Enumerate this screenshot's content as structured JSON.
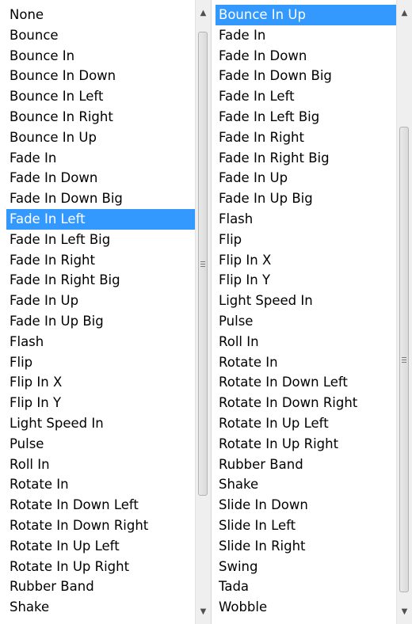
{
  "left_list": {
    "selected_index": 10,
    "items": [
      "None",
      "Bounce",
      "Bounce In",
      "Bounce In Down",
      "Bounce In Left",
      "Bounce In Right",
      "Bounce In Up",
      "Fade In",
      "Fade In Down",
      "Fade In Down Big",
      "Fade In Left",
      "Fade In Left Big",
      "Fade In Right",
      "Fade In Right Big",
      "Fade In Up",
      "Fade In Up Big",
      "Flash",
      "Flip",
      "Flip In X",
      "Flip In Y",
      "Light Speed In",
      "Pulse",
      "Roll In",
      "Rotate In",
      "Rotate In Down Left",
      "Rotate In Down Right",
      "Rotate In Up Left",
      "Rotate In Up Right",
      "Rubber Band",
      "Shake"
    ]
  },
  "right_list": {
    "selected_index": 0,
    "items": [
      "Bounce In Up",
      "Fade In",
      "Fade In Down",
      "Fade In Down Big",
      "Fade In Left",
      "Fade In Left Big",
      "Fade In Right",
      "Fade In Right Big",
      "Fade In Up",
      "Fade In Up Big",
      "Flash",
      "Flip",
      "Flip In X",
      "Flip In Y",
      "Light Speed In",
      "Pulse",
      "Roll In",
      "Rotate In",
      "Rotate In Down Left",
      "Rotate In Down Right",
      "Rotate In Up Left",
      "Rotate In Up Right",
      "Rubber Band",
      "Shake",
      "Slide In Down",
      "Slide In Left",
      "Slide In Right",
      "Swing",
      "Tada",
      "Wobble"
    ]
  },
  "icons": {
    "up_arrow": "scroll-up-arrow-icon",
    "down_arrow": "scroll-down-arrow-icon",
    "thumb_grip": "scrollbar-grip-icon"
  },
  "colors": {
    "selection": "#3399ff",
    "selection_text": "#ffffff"
  }
}
